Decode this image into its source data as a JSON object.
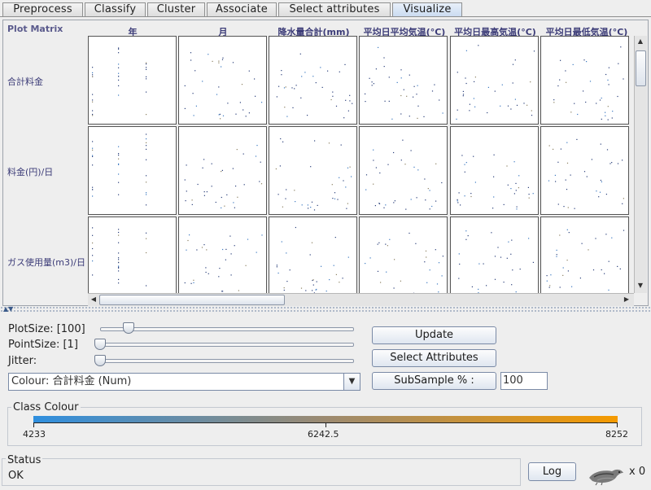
{
  "tabs": [
    {
      "label": "Preprocess",
      "active": false
    },
    {
      "label": "Classify",
      "active": false
    },
    {
      "label": "Cluster",
      "active": false
    },
    {
      "label": "Associate",
      "active": false
    },
    {
      "label": "Select attributes",
      "active": false
    },
    {
      "label": "Visualize",
      "active": true
    }
  ],
  "plot_matrix": {
    "title": "Plot Matrix",
    "columns": [
      "年",
      "月",
      "降水量合計(mm)",
      "平均日平均気温(°C)",
      "平均日最高気温(°C)",
      "平均日最低気温(°C)"
    ],
    "rows": [
      "合計料金",
      "料金(円)/日",
      "ガス使用量(m3)/日"
    ]
  },
  "controls": {
    "plot_size_label": "PlotSize: [100]",
    "point_size_label": "PointSize: [1]",
    "jitter_label": "Jitter:",
    "plot_size_value": 100,
    "point_size_value": 1,
    "jitter_value": 0,
    "colour_select": "Colour: 合計料金  (Num)",
    "update_label": "Update",
    "select_attributes_label": "Select Attributes",
    "subsample_label": "SubSample % :",
    "subsample_value": "100"
  },
  "class_colour": {
    "title": "Class Colour",
    "min_label": "4233",
    "mid_label": "6242.5",
    "max_label": "8252",
    "colors": [
      "#2f8fdf",
      "#9c8a70",
      "#f59a00"
    ]
  },
  "status": {
    "title": "Status",
    "text": "OK",
    "log_label": "Log",
    "task_count": "x 0"
  },
  "colors": {
    "accent": "#3c3c78",
    "point": "#2a4a8a",
    "tab_active": "#c9daf0"
  }
}
